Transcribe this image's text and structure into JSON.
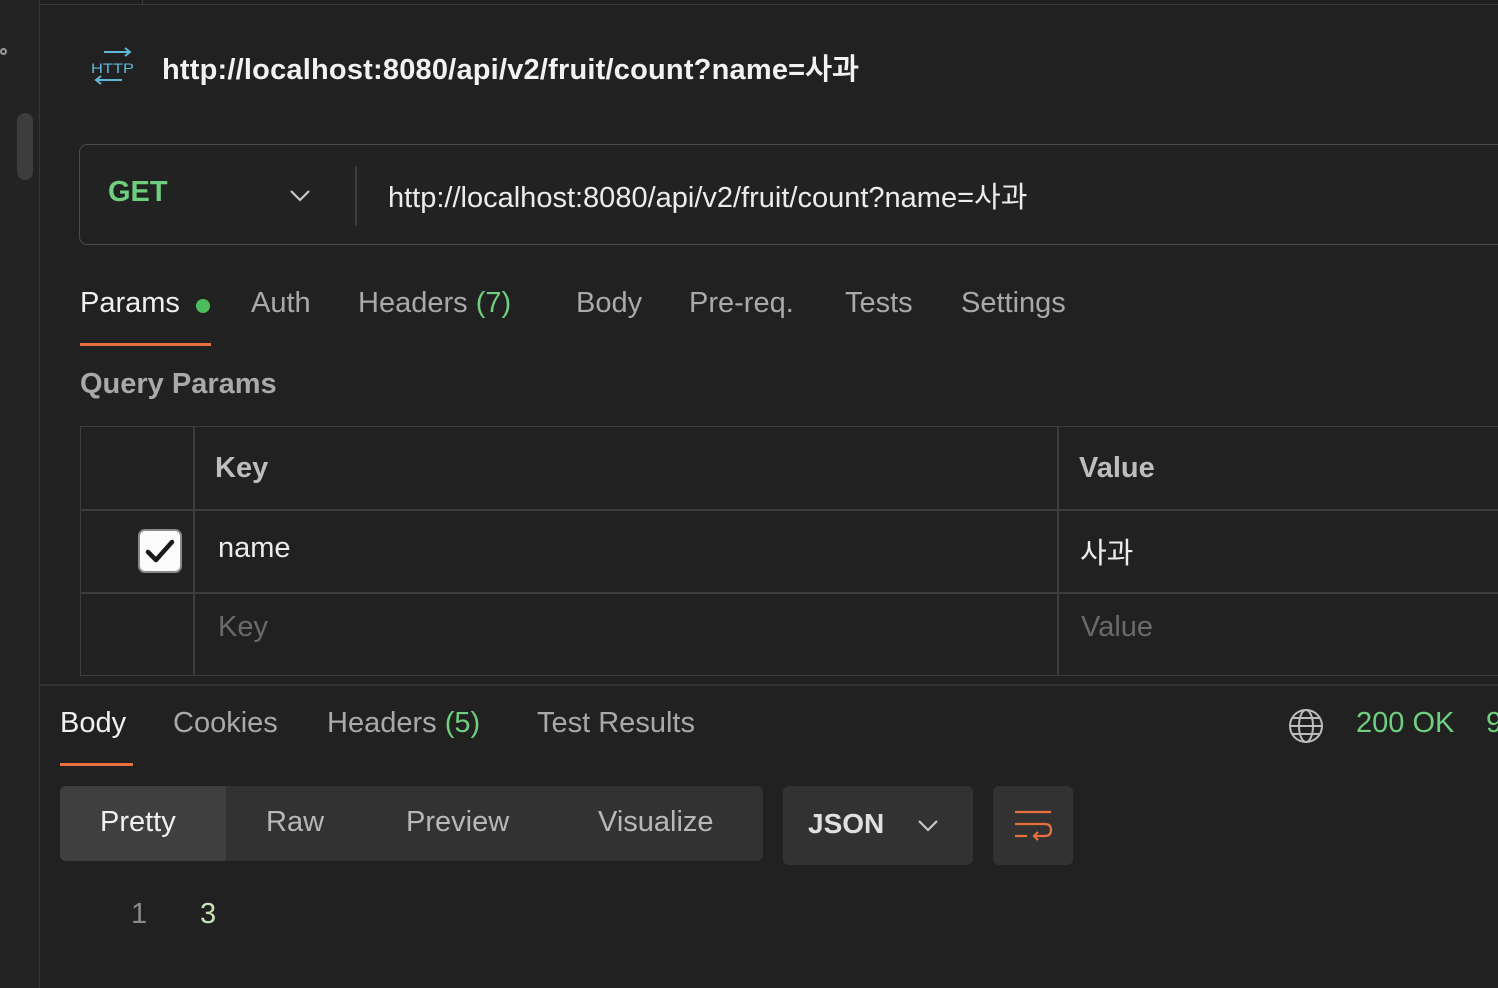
{
  "header": {
    "icon": "http-request-icon",
    "title": "http://localhost:8080/api/v2/fruit/count?name=사과"
  },
  "request": {
    "method": "GET",
    "url": "http://localhost:8080/api/v2/fruit/count?name=사과"
  },
  "request_tabs": {
    "params": "Params",
    "auth": "Auth",
    "headers": "Headers",
    "headers_count": "(7)",
    "body": "Body",
    "prereq": "Pre-req.",
    "tests": "Tests",
    "settings": "Settings"
  },
  "query_params": {
    "label": "Query Params",
    "columns": {
      "key": "Key",
      "value": "Value"
    },
    "rows": [
      {
        "checked": true,
        "key": "name",
        "value": "사과"
      }
    ],
    "placeholder": {
      "key": "Key",
      "value": "Value"
    }
  },
  "response": {
    "tabs": {
      "body": "Body",
      "cookies": "Cookies",
      "headers": "Headers",
      "headers_count": "(5)",
      "test_results": "Test Results"
    },
    "status": "200 OK",
    "status_extra": "9",
    "view_modes": [
      "Pretty",
      "Raw",
      "Preview",
      "Visualize"
    ],
    "active_view_mode": "Pretty",
    "format": "JSON",
    "lines": [
      {
        "number": "1",
        "content": "3"
      }
    ]
  },
  "colors": {
    "accent": "#e8703e",
    "success": "#6fcf7f",
    "background": "#212121"
  }
}
